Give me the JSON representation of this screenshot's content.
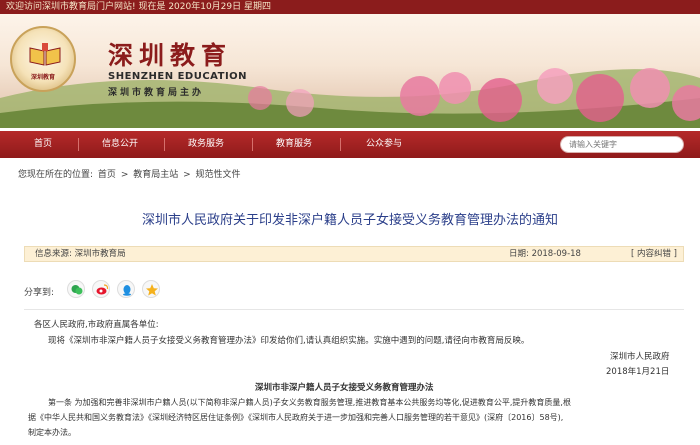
{
  "topbar": {
    "welcome": "欢迎访问深圳市教育局门户网站! 现在是 2020年10月29日 星期四"
  },
  "header": {
    "logo_text": "深圳教育",
    "title_cn": "深圳教育",
    "title_en": "SHENZHEN EDUCATION",
    "subtitle": "深圳市教育局主办"
  },
  "nav": {
    "items": [
      "首页",
      "信息公开",
      "政务服务",
      "教育服务",
      "公众参与"
    ],
    "search_placeholder": "请输入关键字"
  },
  "breadcrumb": {
    "prefix": "您现在所在的位置:",
    "items": [
      "首页",
      "教育局主站",
      "规范性文件"
    ],
    "separator": ">"
  },
  "article": {
    "title": "深圳市人民政府关于印发非深户籍人员子女接受义务教育管理办法的通知",
    "source": "信息来源:  深圳市教育局",
    "date": "日期:  2018-09-18",
    "correct": "[ 内容纠错 ]",
    "share_label": "分享到:",
    "share_icons": [
      "wechat-icon",
      "weibo-icon",
      "qq-icon",
      "qzone-icon"
    ],
    "salutation": "各区人民政府,市政府直属各单位:",
    "intro": "现将《深圳市非深户籍人员子女接受义务教育管理办法》印发给你们,请认真组织实施。实施中遇到的问题,请径向市教育局反映。",
    "signer": "深圳市人民政府",
    "sign_date": "2018年1月21日",
    "doc_title": "深圳市非深户籍人员子女接受义务教育管理办法",
    "article1_line1": "第一条  为加强和完善非深圳市户籍人员(以下简称非深户籍人员)子女义务教育服务管理,推进教育基本公共服务均等化,促进教育公平,提升教育质量,根",
    "article1_line2": "据《中华人民共和国义务教育法》《深圳经济特区居住证条例》《深圳市人民政府关于进一步加强和完善人口服务管理的若干意见》(深府〔2016〕58号),",
    "article1_line3": "制定本办法。"
  },
  "colors": {
    "brand": "#8b1c1c",
    "nav": "#a52222",
    "title": "#2b3f8a",
    "info_bar": "#fdf0d5"
  }
}
